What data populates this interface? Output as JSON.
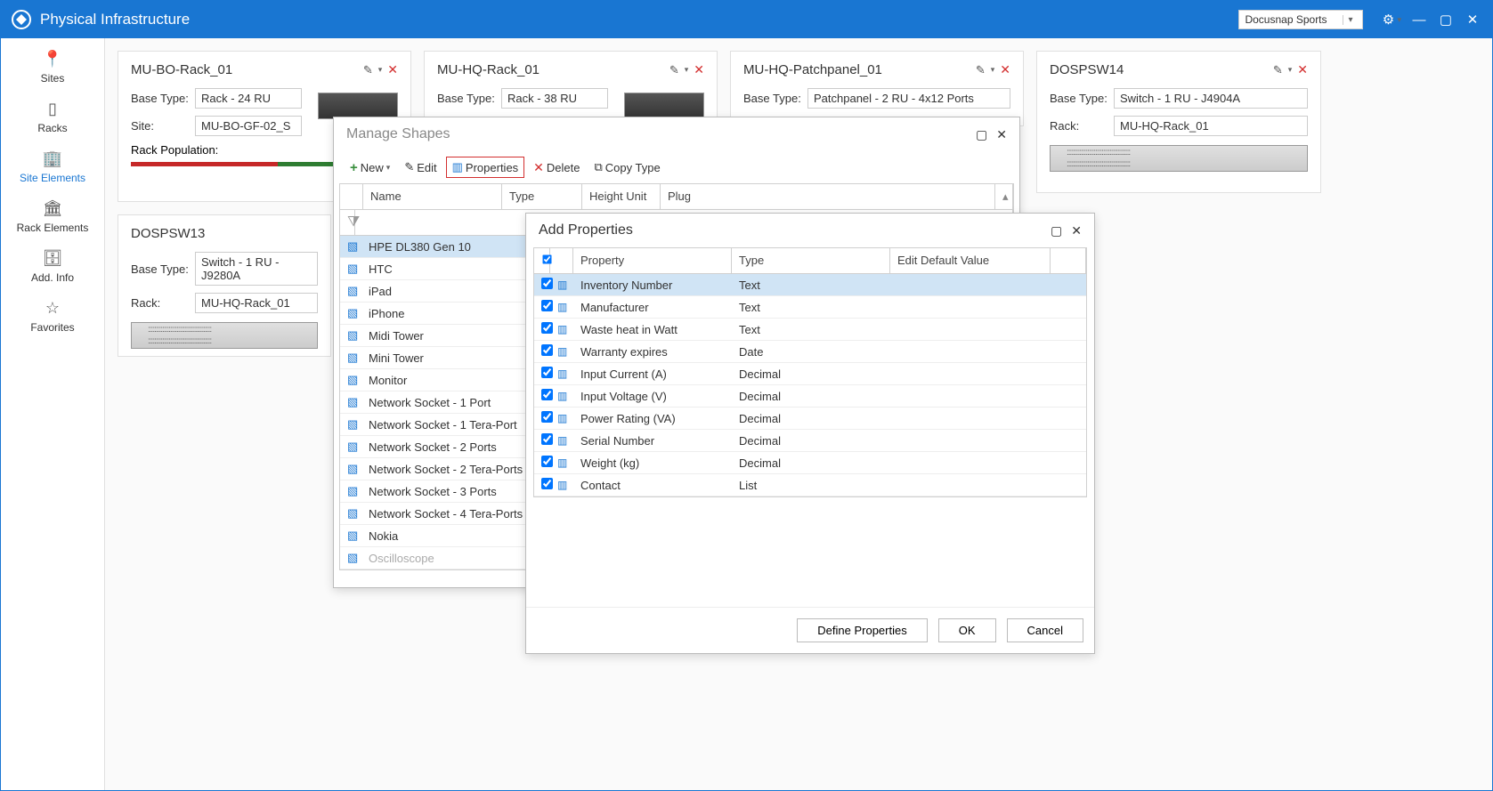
{
  "titlebar": {
    "title": "Physical Infrastructure",
    "tenant": "Docusnap Sports"
  },
  "sidebar": {
    "items": [
      {
        "label": "Sites"
      },
      {
        "label": "Racks"
      },
      {
        "label": "Site Elements"
      },
      {
        "label": "Rack Elements"
      },
      {
        "label": "Add. Info"
      },
      {
        "label": "Favorites"
      }
    ]
  },
  "cards": {
    "rack1": {
      "title": "MU-BO-Rack_01",
      "baseTypeLabel": "Base Type:",
      "baseType": "Rack - 24 RU",
      "siteLabel": "Site:",
      "site": "MU-BO-GF-02_S",
      "popLabel": "Rack Population:"
    },
    "rack2": {
      "title": "MU-HQ-Rack_01",
      "baseTypeLabel": "Base Type:",
      "baseType": "Rack - 38 RU"
    },
    "pp1": {
      "title": "MU-HQ-Patchpanel_01",
      "baseTypeLabel": "Base Type:",
      "baseType": "Patchpanel - 2 RU - 4x12 Ports"
    },
    "sw14": {
      "title": "DOSPSW14",
      "baseTypeLabel": "Base Type:",
      "baseType": "Switch - 1 RU - J4904A",
      "rackLabel": "Rack:",
      "rack": "MU-HQ-Rack_01"
    },
    "sw13": {
      "title": "DOSPSW13",
      "baseTypeLabel": "Base Type:",
      "baseType": "Switch - 1 RU - J9280A",
      "rackLabel": "Rack:",
      "rack": "MU-HQ-Rack_01"
    }
  },
  "manageShapes": {
    "title": "Manage Shapes",
    "toolbar": {
      "new": "New",
      "edit": "Edit",
      "properties": "Properties",
      "delete": "Delete",
      "copyType": "Copy Type"
    },
    "cols": {
      "name": "Name",
      "type": "Type",
      "hu": "Height Unit",
      "plug": "Plug"
    },
    "rows": [
      "HPE DL380 Gen 10",
      "HTC",
      "iPad",
      "iPhone",
      "Midi Tower",
      "Mini Tower",
      "Monitor",
      "Network Socket - 1 Port",
      "Network Socket - 1 Tera-Port",
      "Network Socket - 2 Ports",
      "Network Socket - 2 Tera-Ports",
      "Network Socket - 3 Ports",
      "Network Socket - 4 Tera-Ports",
      "Nokia",
      "Oscilloscope"
    ]
  },
  "addProps": {
    "title": "Add Properties",
    "cols": {
      "prop": "Property",
      "type": "Type",
      "edv": "Edit Default Value"
    },
    "rows": [
      {
        "name": "Inventory Number",
        "type": "Text"
      },
      {
        "name": "Manufacturer",
        "type": "Text"
      },
      {
        "name": "Waste heat in Watt",
        "type": "Text"
      },
      {
        "name": "Warranty expires",
        "type": "Date"
      },
      {
        "name": "Input Current (A)",
        "type": "Decimal"
      },
      {
        "name": "Input Voltage (V)",
        "type": "Decimal"
      },
      {
        "name": "Power Rating (VA)",
        "type": "Decimal"
      },
      {
        "name": "Serial Number",
        "type": "Decimal"
      },
      {
        "name": "Weight (kg)",
        "type": "Decimal"
      },
      {
        "name": "Contact",
        "type": "List"
      }
    ],
    "buttons": {
      "define": "Define Properties",
      "ok": "OK",
      "cancel": "Cancel"
    }
  }
}
